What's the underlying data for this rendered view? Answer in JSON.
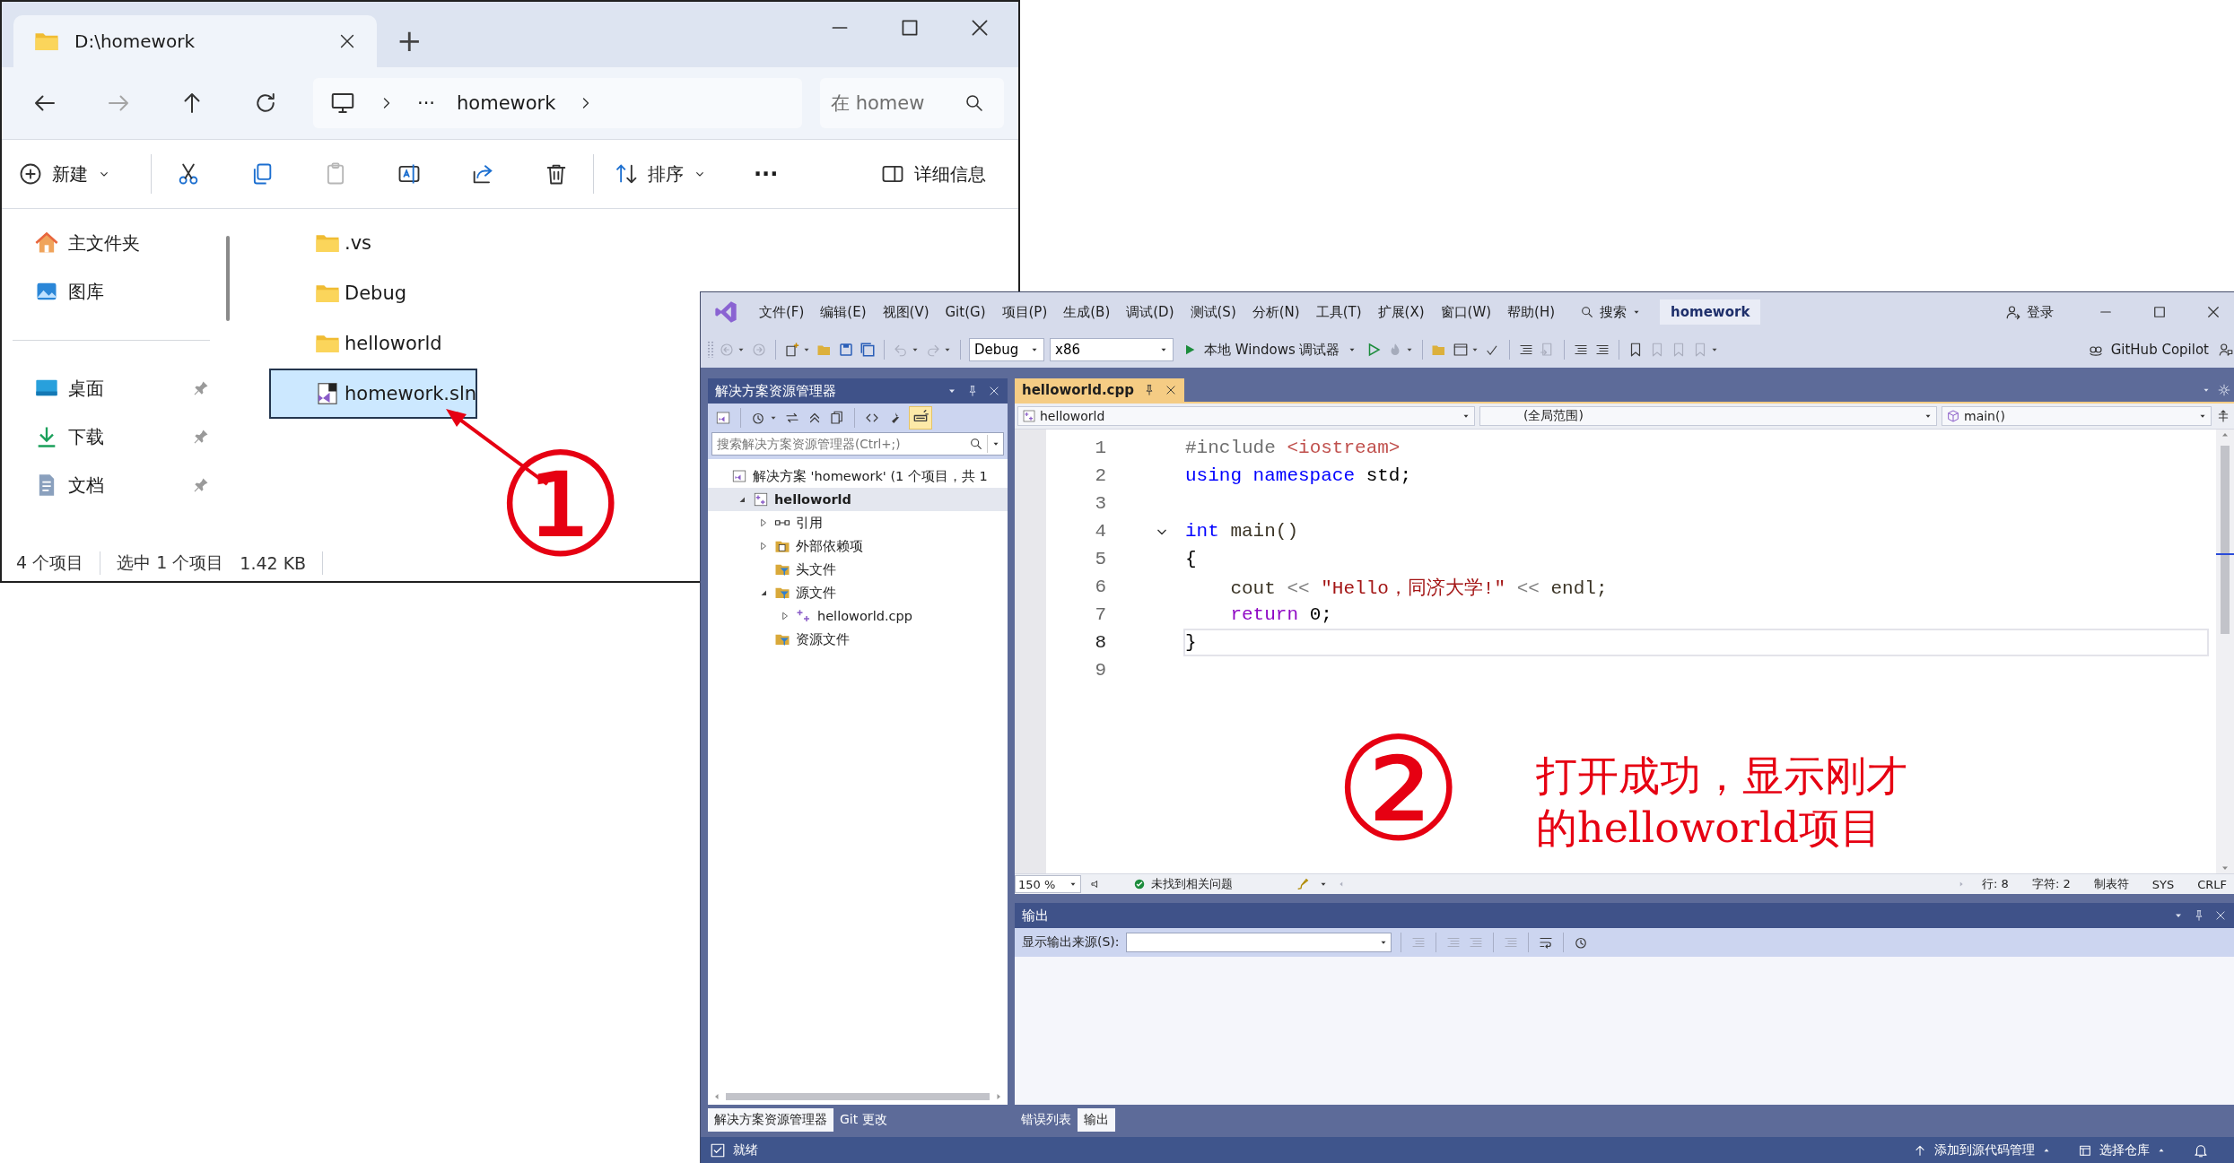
{
  "explorer": {
    "tab_title": "D:\\homework",
    "new_tab": "+",
    "nav_buttons": [
      {
        "kind": "back",
        "disabled": false
      },
      {
        "kind": "forward",
        "disabled": true
      },
      {
        "kind": "up",
        "disabled": false
      },
      {
        "kind": "refresh",
        "disabled": false
      }
    ],
    "address": {
      "overflow": "···",
      "segment": "homework"
    },
    "search": {
      "placeholder": "在 homew"
    },
    "commands": [
      {
        "kind": "new",
        "label": "新建",
        "disabled": false
      },
      {
        "kind": "cut",
        "disabled": false
      },
      {
        "kind": "copy",
        "disabled": false
      },
      {
        "kind": "paste",
        "disabled": true
      },
      {
        "kind": "rename",
        "disabled": false
      },
      {
        "kind": "share",
        "disabled": false
      },
      {
        "kind": "delete",
        "disabled": false
      },
      {
        "kind": "sort",
        "label": "排序",
        "disabled": false
      },
      {
        "kind": "more",
        "label": "···",
        "disabled": false
      }
    ],
    "details": "详细信息",
    "nav_groups": [
      [
        {
          "label": "主文件夹",
          "kind": "home",
          "pinned": false
        },
        {
          "label": "图库",
          "kind": "gallery",
          "pinned": false
        }
      ],
      [
        {
          "label": "桌面",
          "kind": "desktop",
          "pinned": true
        },
        {
          "label": "下载",
          "kind": "download",
          "pinned": true
        },
        {
          "label": "文档",
          "kind": "documents",
          "pinned": true
        }
      ]
    ],
    "files": [
      {
        "name": ".vs",
        "kind": "folder",
        "selected": false
      },
      {
        "name": "Debug",
        "kind": "folder",
        "selected": false
      },
      {
        "name": "helloworld",
        "kind": "folder",
        "selected": false
      },
      {
        "name": "homework.sln",
        "kind": "solution",
        "selected": true
      }
    ],
    "status": {
      "count": "4 个项目",
      "selection": "选中 1 个项目",
      "size": "1.42 KB"
    }
  },
  "vs": {
    "menus": [
      "文件(F)",
      "编辑(E)",
      "视图(V)",
      "Git(G)",
      "项目(P)",
      "生成(B)",
      "调试(D)",
      "测试(S)",
      "分析(N)",
      "工具(T)",
      "扩展(X)",
      "窗口(W)",
      "帮助(H)"
    ],
    "search": "搜索",
    "solution_name": "homework",
    "sign_in": "登录",
    "toolbar": {
      "configuration": "Debug",
      "platform": "x86",
      "debugger": "本地 Windows 调试器",
      "copilot": "GitHub Copilot"
    },
    "solution_explorer": {
      "title": "解决方案资源管理器",
      "preview_on": true,
      "search": {
        "placeholder": "搜索解决方案资源管理器(Ctrl+;)"
      },
      "tree": [
        {
          "label": "解决方案 'homework' (1 个项目，共 1",
          "kind": "solution",
          "selected": false,
          "children": [
            {
              "label": "helloworld",
              "kind": "project",
              "expanded": true,
              "selected": true,
              "children": [
                {
                  "label": "引用",
                  "kind": "references",
                  "expanded": false,
                  "selected": false
                },
                {
                  "label": "外部依赖项",
                  "kind": "dependencies",
                  "expanded": false,
                  "selected": false
                },
                {
                  "label": "头文件",
                  "kind": "filter",
                  "selected": false
                },
                {
                  "label": "源文件",
                  "kind": "filter",
                  "expanded": true,
                  "selected": false,
                  "children": [
                    {
                      "label": "helloworld.cpp",
                      "kind": "source",
                      "expanded": false,
                      "selected": false
                    }
                  ]
                },
                {
                  "label": "资源文件",
                  "kind": "filter",
                  "selected": false
                }
              ]
            }
          ]
        }
      ],
      "tabs": [
        {
          "label": "解决方案资源管理器",
          "selected": true
        },
        {
          "label": "Git 更改",
          "selected": false
        }
      ]
    },
    "editor": {
      "tabs": [
        {
          "label": "helloworld.cpp",
          "selected": true
        }
      ],
      "nav": {
        "project": "helloworld",
        "scope": "(全局范围)",
        "member": "main()"
      },
      "lines": [
        {
          "number": "1",
          "current": false,
          "fold": false,
          "tokens": [
            {
              "text": "#include ",
              "kind": "directive"
            },
            {
              "text": "<iostream>",
              "kind": "header"
            }
          ]
        },
        {
          "number": "2",
          "current": false,
          "fold": false,
          "tokens": [
            {
              "text": "using namespace",
              "kind": "keyword"
            },
            {
              "text": " std;",
              "kind": "plain"
            }
          ]
        },
        {
          "number": "3",
          "current": false,
          "fold": false
        },
        {
          "number": "4",
          "current": false,
          "fold": true,
          "tokens": [
            {
              "text": "int",
              "kind": "keyword"
            },
            {
              "text": " main()",
              "kind": "identifier"
            }
          ]
        },
        {
          "number": "5",
          "current": false,
          "fold": false,
          "tokens": [
            {
              "text": "{",
              "kind": "plain"
            }
          ]
        },
        {
          "number": "6",
          "current": false,
          "fold": false,
          "tokens": [
            {
              "text": "    cout ",
              "kind": "identifier"
            },
            {
              "text": "<<",
              "kind": "operator"
            },
            {
              "text": " \"Hello，同济大学!\"",
              "kind": "string"
            },
            {
              "text": " <<",
              "kind": "operator"
            },
            {
              "text": " endl;",
              "kind": "identifier"
            }
          ]
        },
        {
          "number": "7",
          "current": false,
          "fold": false,
          "tokens": [
            {
              "text": "    return",
              "kind": "control"
            },
            {
              "text": " 0;",
              "kind": "plain"
            }
          ]
        },
        {
          "number": "8",
          "current": true,
          "fold": false,
          "tokens": [
            {
              "text": "}",
              "kind": "plain"
            }
          ]
        },
        {
          "number": "9",
          "current": false,
          "fold": false
        }
      ],
      "status": {
        "zoom": "150 %",
        "issues": "未找到相关问题",
        "line": "行: 8",
        "column": "字符: 2",
        "indent": "制表符",
        "encoding": "SYS",
        "eol": "CRLF"
      }
    },
    "output": {
      "title": "输出",
      "source_label": "显示输出来源(S):",
      "tabs": [
        {
          "label": "错误列表",
          "selected": false
        },
        {
          "label": "输出",
          "selected": true
        }
      ]
    },
    "status_bar": {
      "state": "就绪",
      "source_control": "添加到源代码管理",
      "repository": "选择仓库"
    }
  },
  "annotations": {
    "step1": {
      "marker": "①"
    },
    "step2": {
      "marker": "②",
      "note": "打开成功，显示刚才的helloworld项目"
    }
  }
}
